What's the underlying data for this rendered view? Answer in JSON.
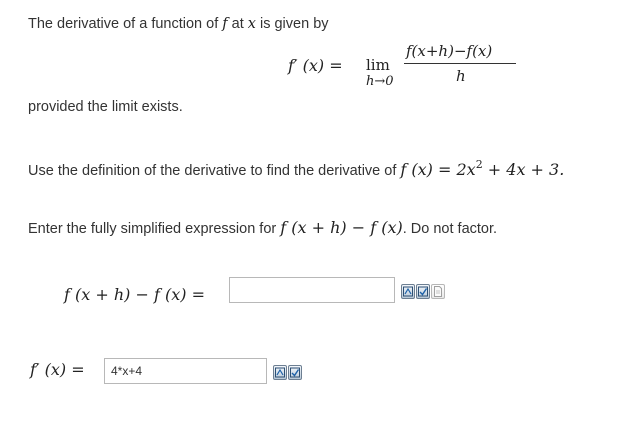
{
  "intro": {
    "text_before": "The derivative of a function of ",
    "f_symbol": "f",
    "text_mid": " at ",
    "x_symbol": "x",
    "text_after": " is given by"
  },
  "definition": {
    "lhs": "f′ (x) =",
    "lim": "lim",
    "lim_subscript": "h→0",
    "numerator": "f(x+h)−f(x)",
    "denominator": "h"
  },
  "provided": "provided the limit exists.",
  "problem": {
    "text": "Use the definition of the derivative to find the derivative of ",
    "function_lhs": "f (x) = 2x",
    "exponent": "2",
    "function_rhs": " + 4x + 3."
  },
  "instruction": {
    "text_before": "Enter the fully simplified expression for ",
    "expression": "f (x + h) − f (x)",
    "text_after": ". Do not factor."
  },
  "answers": {
    "difference_label": "f (x + h) − f (x) =",
    "difference_value": "",
    "derivative_label": "f′ (x) =",
    "derivative_value": "4*x+4"
  }
}
